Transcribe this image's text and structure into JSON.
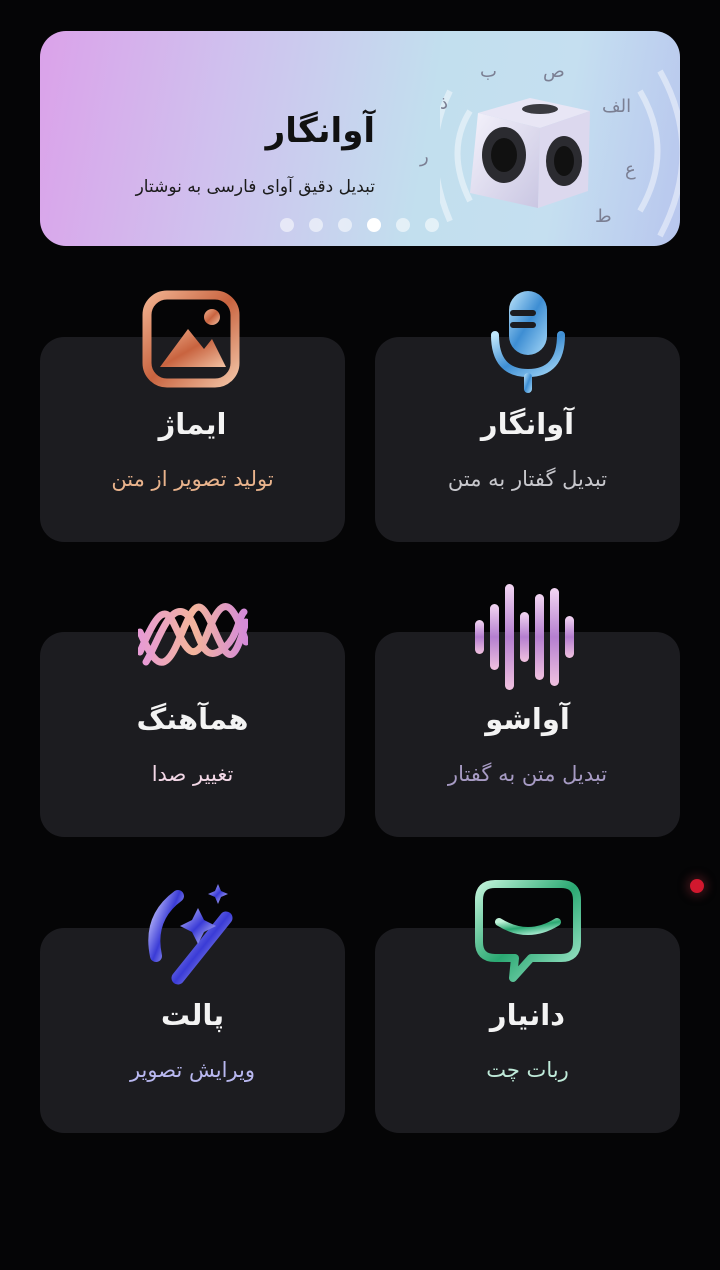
{
  "banner": {
    "title": "آوانگار",
    "subtitle": "تبدیل دقیق آوای فارسی به نوشتار",
    "letters": [
      "ص",
      "ب",
      "الف",
      "ذ",
      "ر",
      "ع",
      "ط"
    ],
    "slides_count": 6,
    "active_slide": 4
  },
  "cards": [
    {
      "title": "ایماژ",
      "subtitle": "تولید تصویر از متن",
      "subtitle_color": "#e9b38c",
      "icon": "image-icon"
    },
    {
      "title": "آوانگار",
      "subtitle": "تبدیل گفتار به متن",
      "subtitle_color": "#c7c7cc",
      "icon": "microphone-icon"
    },
    {
      "title": "همآهنگ",
      "subtitle": "تغییر صدا",
      "subtitle_color": "#f2d7e6",
      "icon": "wave-icon"
    },
    {
      "title": "آواشو",
      "subtitle": "تبدیل متن به گفتار",
      "subtitle_color": "#a79bc4",
      "icon": "sound-bars-icon"
    },
    {
      "title": "پالت",
      "subtitle": "ویرایش تصویر",
      "subtitle_color": "#b9b8f0",
      "icon": "magic-wand-icon"
    },
    {
      "title": "دانیار",
      "subtitle": "ربات چت",
      "subtitle_color": "#bfead9",
      "icon": "chat-icon"
    }
  ],
  "colors": {
    "background": "#050506",
    "card": "#1c1c20",
    "status_dot": "#d1182e"
  }
}
